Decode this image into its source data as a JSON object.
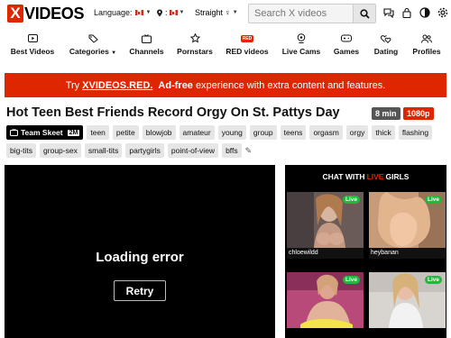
{
  "header": {
    "logo_x": "X",
    "logo_text": "VIDEOS",
    "language_label": "Language:",
    "location_label": ":",
    "orientation_label": "Straight",
    "search_placeholder": "Search X videos"
  },
  "nav": [
    {
      "label": "Best Videos",
      "icon": "play-square-icon"
    },
    {
      "label": "Categories",
      "icon": "tags-icon"
    },
    {
      "label": "Channels",
      "icon": "tv-icon"
    },
    {
      "label": "Pornstars",
      "icon": "star-icon"
    },
    {
      "label": "RED videos",
      "icon": "red-icon",
      "badge": "RED"
    },
    {
      "label": "Live Cams",
      "icon": "webcam-icon"
    },
    {
      "label": "Games",
      "icon": "gamepad-icon"
    },
    {
      "label": "Dating",
      "icon": "hearts-icon"
    },
    {
      "label": "Profiles",
      "icon": "profiles-icon"
    }
  ],
  "banner": {
    "pre": "Try",
    "brand": "XVIDEOS.RED.",
    "bold": "Ad-free",
    "post": "experience with extra content and features."
  },
  "video": {
    "title": "Hot Teen Best Friends Record Orgy On St. Pattys Day",
    "duration": "8 min",
    "quality": "1080p",
    "channel": "Team Skeet",
    "channel_count": "2M",
    "tags_row1": [
      "teen",
      "petite",
      "blowjob",
      "amateur",
      "young",
      "group",
      "teens",
      "orgasm",
      "orgy",
      "thick",
      "flashing"
    ],
    "tags_row2": [
      "big-tits",
      "group-sex",
      "small-tits",
      "partygirls",
      "point-of-view",
      "bffs"
    ]
  },
  "player": {
    "error": "Loading error",
    "retry": "Retry"
  },
  "cams": {
    "hdr_pre": "CHAT WITH",
    "hdr_live": "LIVE",
    "hdr_post": "GIRLS",
    "live_badge": "Live",
    "names": [
      "chloewildd",
      "heybanan"
    ]
  },
  "colors": {
    "brand_red": "#de2600",
    "live_green": "#22b83a"
  }
}
